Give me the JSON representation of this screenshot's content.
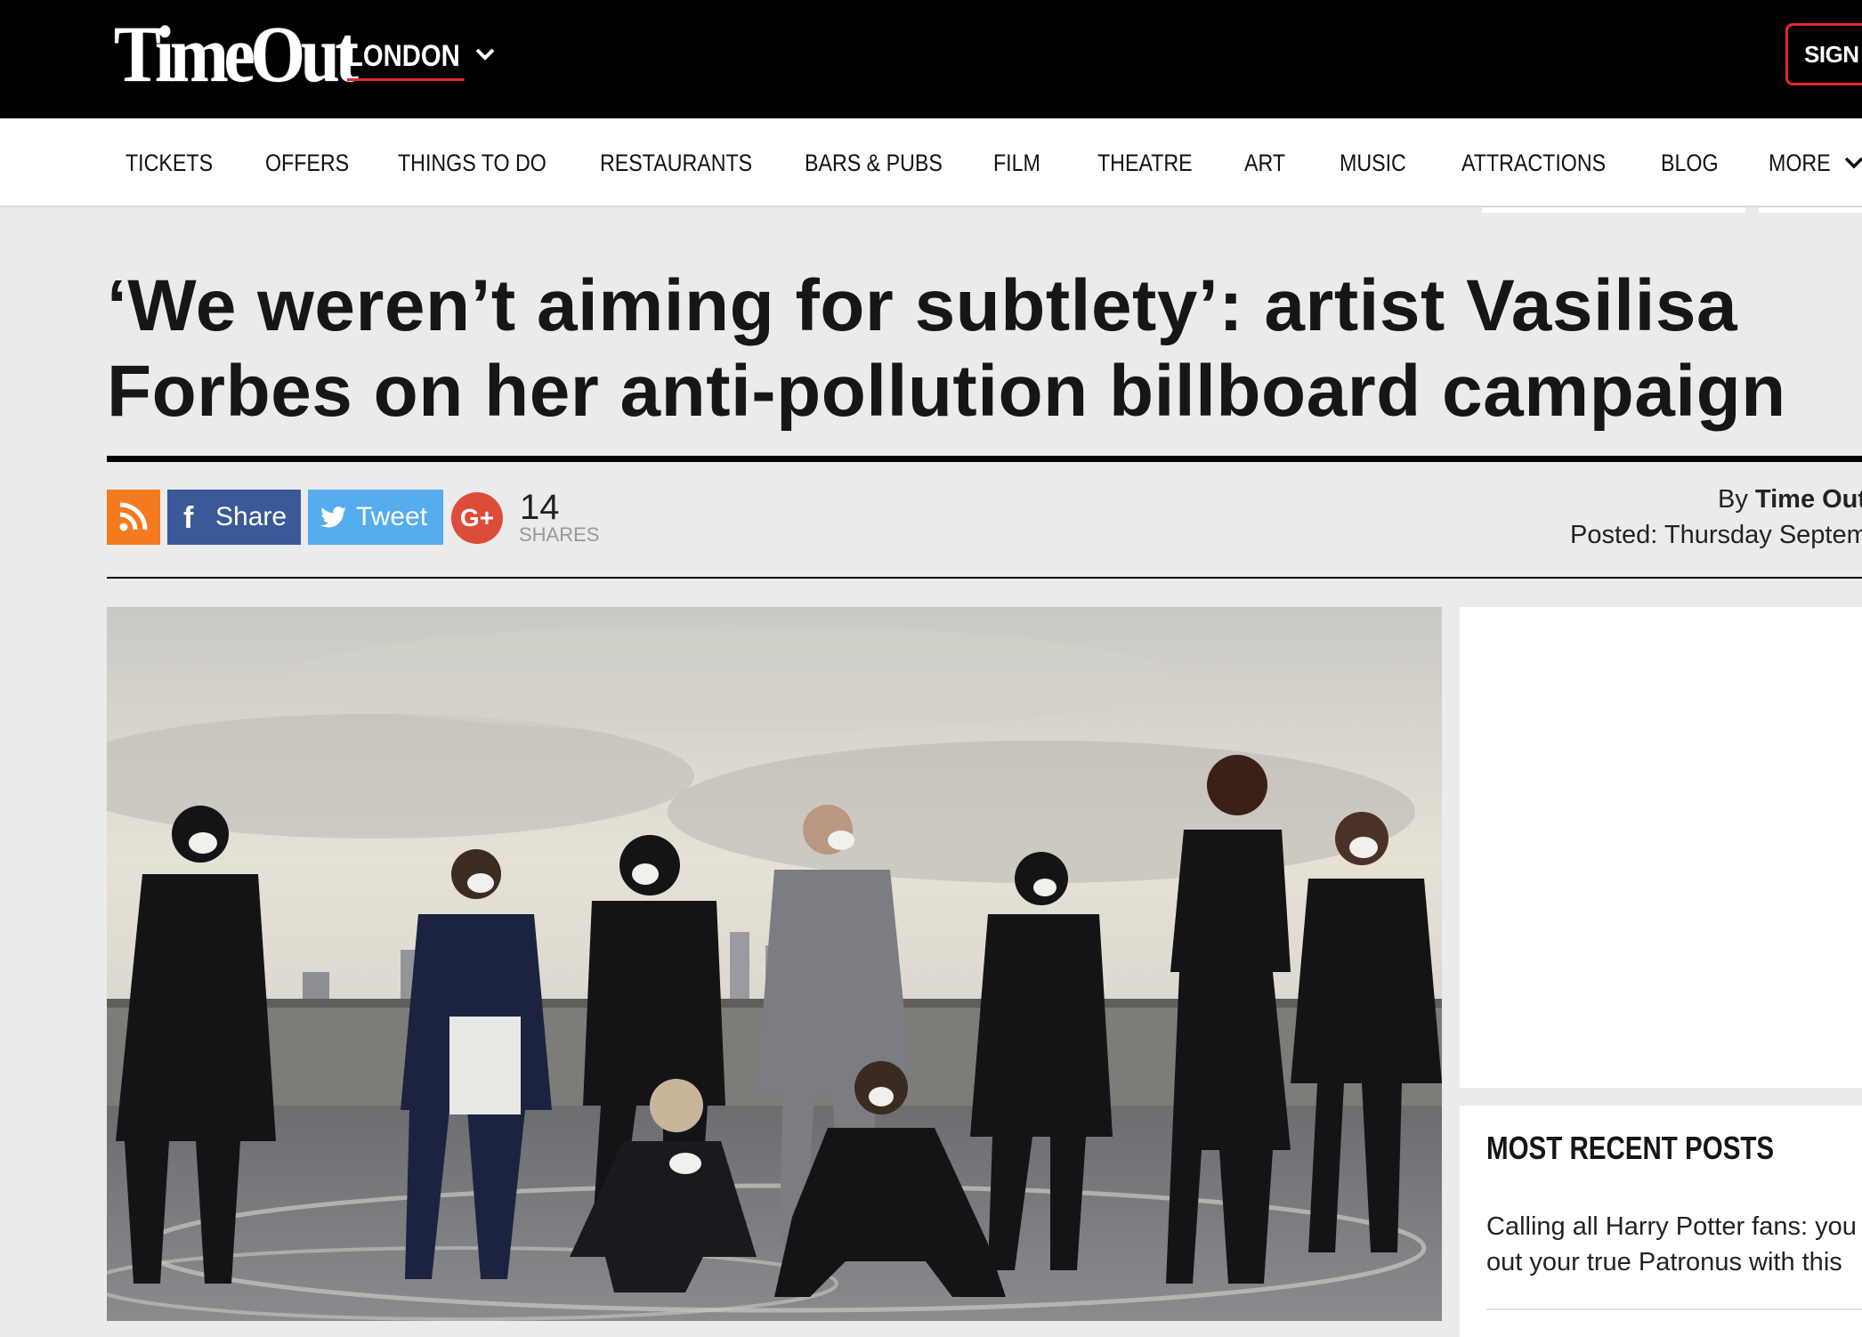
{
  "header": {
    "logo": "TimeOut",
    "city": "LONDON",
    "signin": "SIGN I"
  },
  "nav": {
    "items": [
      "TICKETS",
      "OFFERS",
      "THINGS TO DO",
      "RESTAURANTS",
      "BARS & PUBS",
      "FILM",
      "THEATRE",
      "ART",
      "MUSIC",
      "ATTRACTIONS",
      "BLOG",
      "MORE"
    ]
  },
  "article": {
    "headline": "‘We weren’t aiming for subtlety’: artist Vasilisa Forbes on her anti-pollution billboard campaign",
    "share": {
      "facebook": "Share",
      "twitter": "Tweet",
      "google": "G+",
      "count": "14",
      "count_label": "SHARES"
    },
    "byline_prefix": "By",
    "author": "Time Out",
    "posted": "Posted: Thursday Septem"
  },
  "sidebar": {
    "recent_title": "MOST RECENT POSTS",
    "recent_items": [
      "Calling all Harry Potter fans: you",
      "out your true Patronus with this"
    ]
  },
  "colors": {
    "brand_red": "#e8262e",
    "rss": "#f47a20",
    "facebook": "#3b5998",
    "twitter": "#55acee",
    "google": "#dd4b39"
  }
}
